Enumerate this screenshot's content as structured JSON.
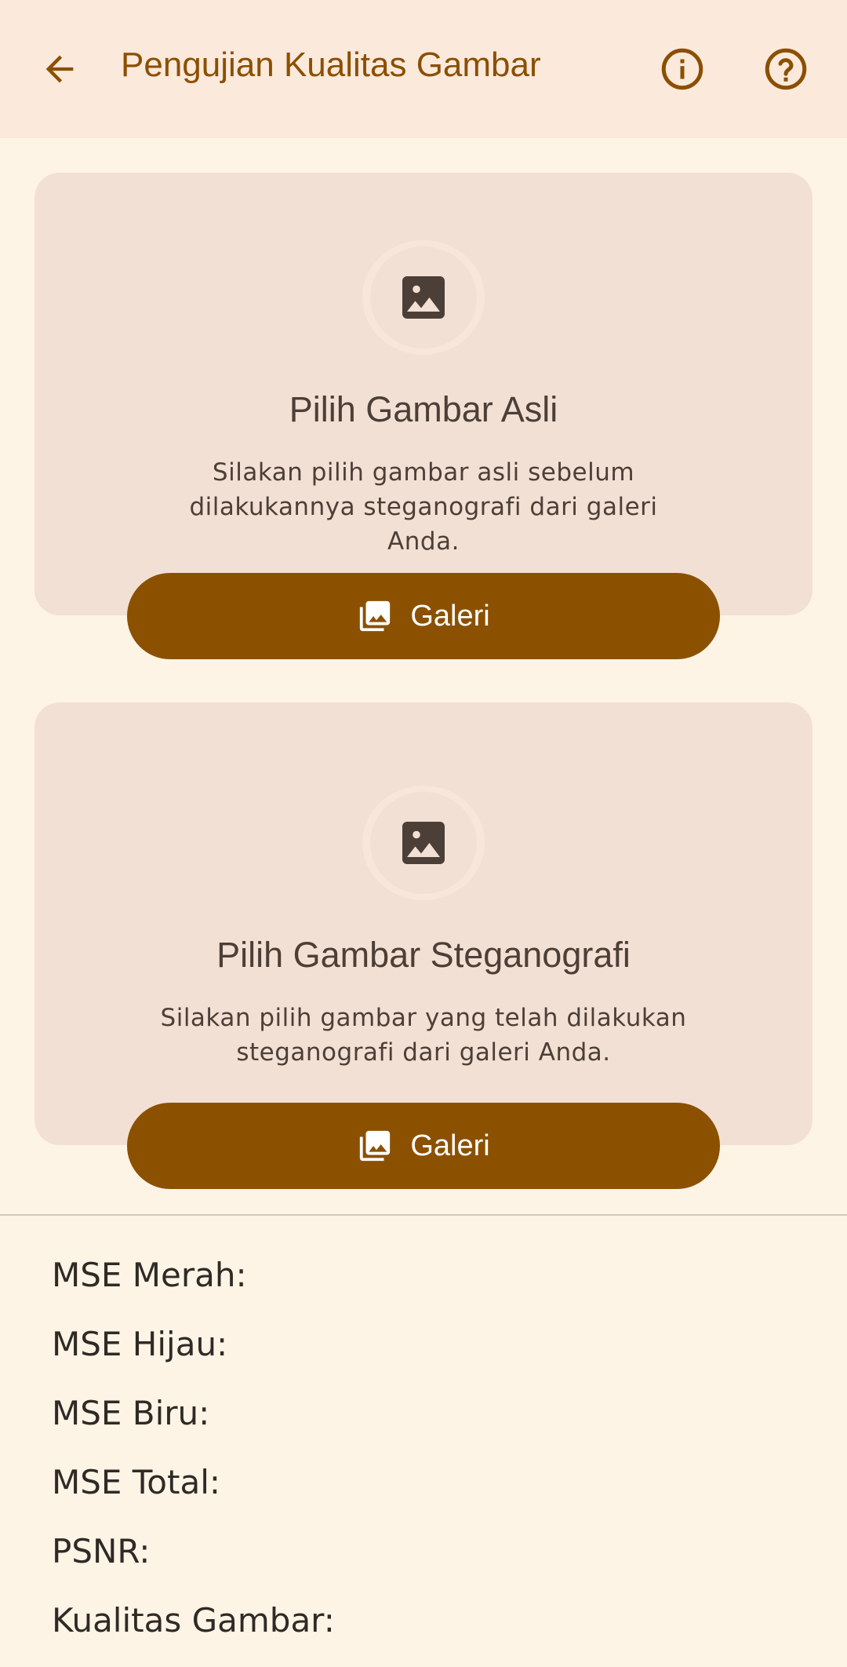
{
  "header": {
    "title": "Pengujian Kualitas Gambar",
    "back_icon": "arrow-back-icon",
    "info_icon": "info-icon",
    "help_icon": "help-icon"
  },
  "cards": [
    {
      "icon": "image-icon",
      "title": "Pilih Gambar Asli",
      "description": "Silakan pilih gambar asli sebelum dilakukannya steganografi dari galeri Anda.",
      "button_label": "Galeri",
      "button_icon": "photo-library-icon"
    },
    {
      "icon": "image-icon",
      "title": "Pilih Gambar Steganografi",
      "description": "Silakan pilih gambar yang telah dilakukan steganografi dari galeri Anda.",
      "button_label": "Galeri",
      "button_icon": "photo-library-icon"
    }
  ],
  "results": {
    "mse_red": "MSE Merah:",
    "mse_green": "MSE Hijau:",
    "mse_blue": "MSE Biru:",
    "mse_total": "MSE Total:",
    "psnr": "PSNR:",
    "quality": "Kualitas Gambar:"
  },
  "colors": {
    "accent": "#8b5101",
    "background": "#fef4e6",
    "card": "#f2e0d4",
    "appbar": "#fbe9dc"
  }
}
